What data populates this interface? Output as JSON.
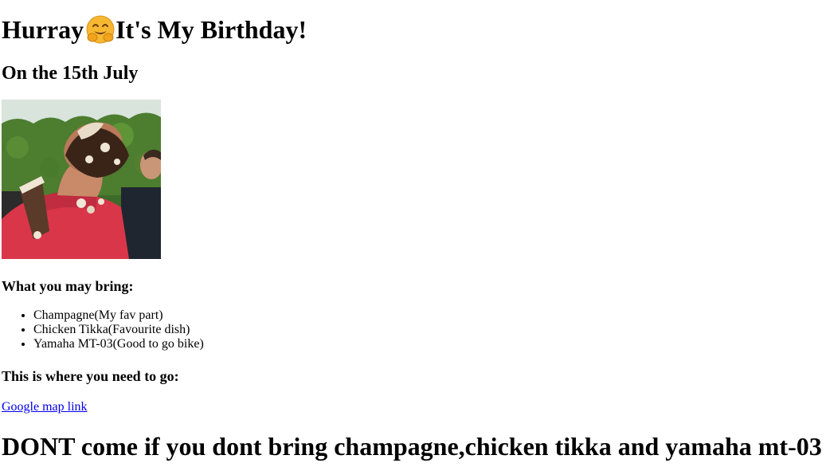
{
  "header": {
    "title_before": "Hurray",
    "emoji_icon": "hugging-face-emoji",
    "title_after": "It's My Birthday!",
    "date": "On the 15th July"
  },
  "photo": {
    "alt": "Birthday person with cake smashed on face"
  },
  "bring": {
    "heading": "What you may bring:",
    "items": [
      "Champagne(My fav part)",
      "Chicken Tikka(Favourite dish)",
      "Yamaha MT-03(Good to go bike)"
    ]
  },
  "location": {
    "heading": "This is where you need to go:",
    "link_text": "Google map link"
  },
  "warning": "DONT come if you dont bring champagne,chicken tikka and yamaha mt-03",
  "colors": {
    "link": "#0000ee",
    "text": "#000000",
    "background": "#ffffff"
  }
}
